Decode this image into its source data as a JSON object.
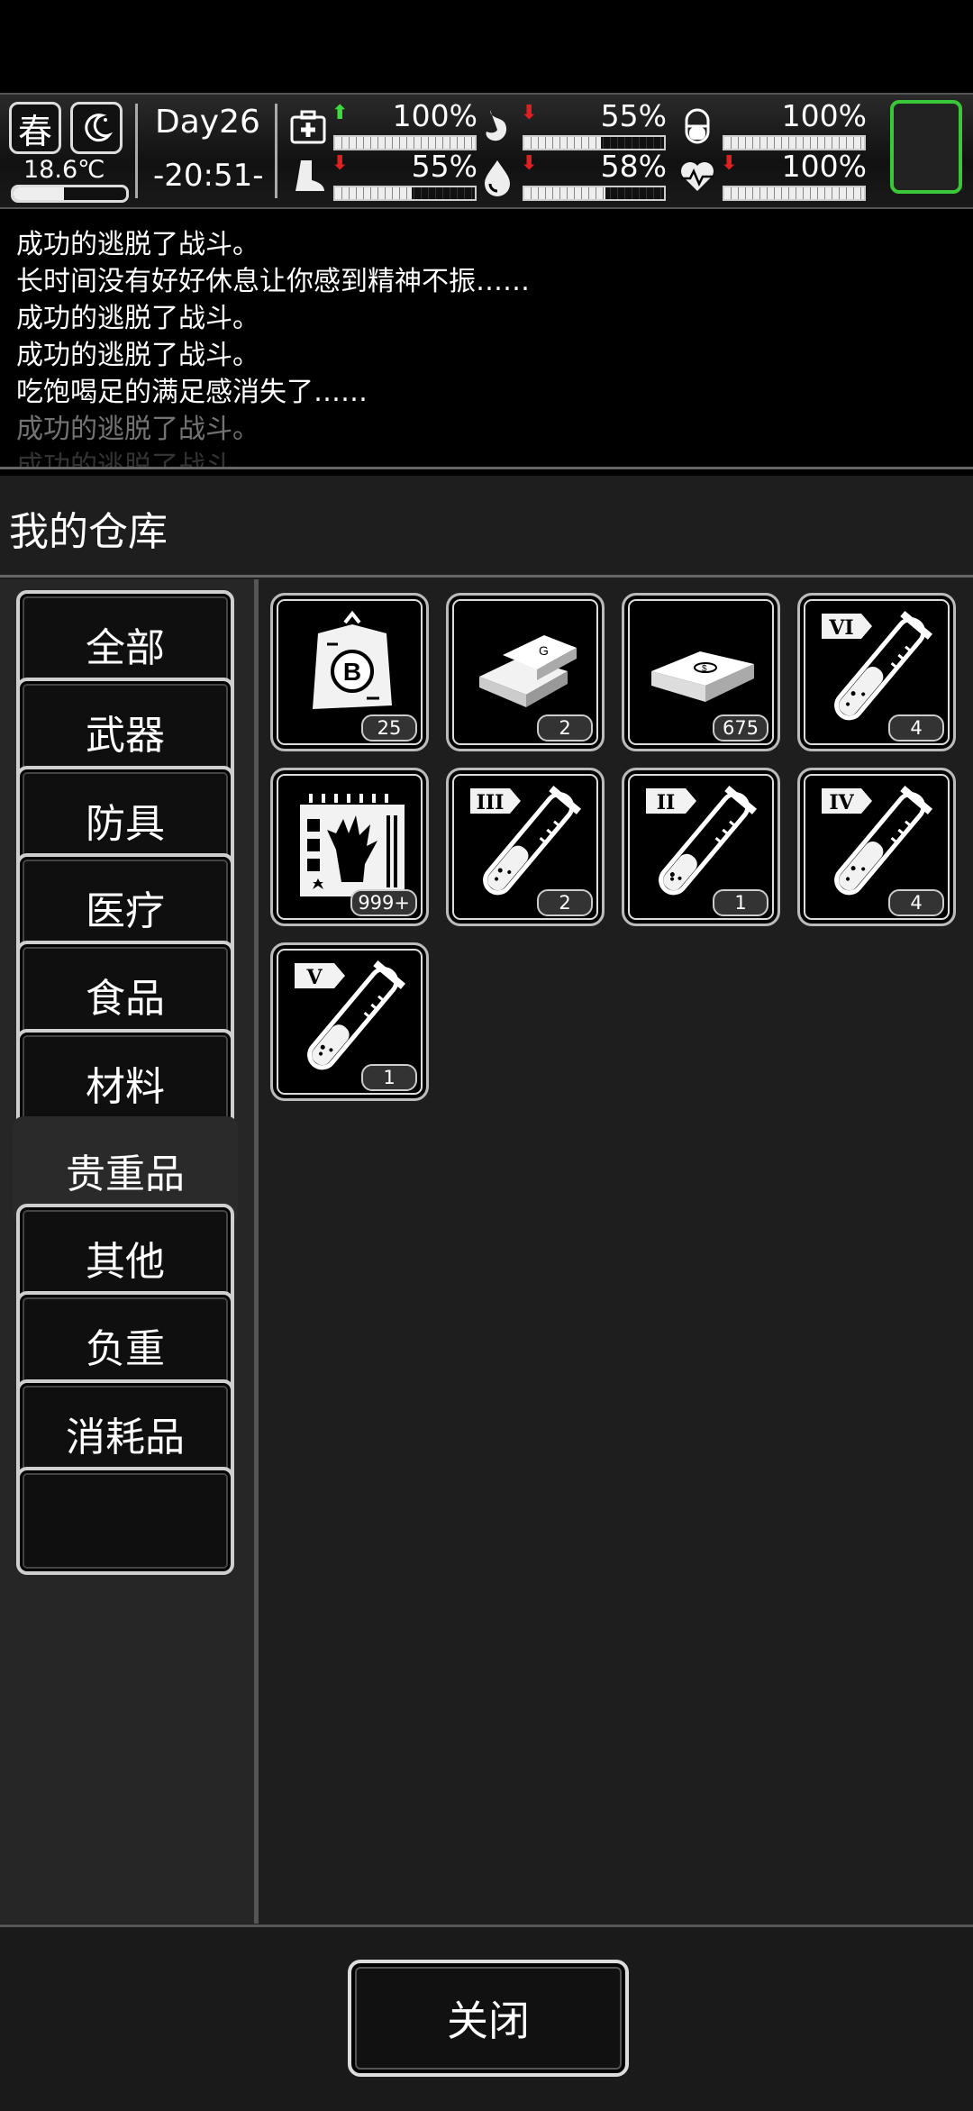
{
  "status": {
    "season": "春",
    "temperature": "18.6℃",
    "temperature_level": 0.45,
    "day": "Day26",
    "time": "-20:51-",
    "stats": [
      {
        "icon": "medkit-icon",
        "value": "100%",
        "level": 1.0,
        "trend": "up"
      },
      {
        "icon": "stomach-icon",
        "value": "55%",
        "level": 0.55,
        "trend": "down"
      },
      {
        "icon": "pill-icon",
        "value": "100%",
        "level": 1.0,
        "trend": "none"
      },
      {
        "icon": "foot-icon",
        "value": "55%",
        "level": 0.55,
        "trend": "down"
      },
      {
        "icon": "water-drop-icon",
        "value": "58%",
        "level": 0.58,
        "trend": "down"
      },
      {
        "icon": "heart-icon",
        "value": "100%",
        "level": 1.0,
        "trend": "down"
      }
    ]
  },
  "log": [
    "成功的逃脱了战斗。",
    "长时间没有好好休息让你感到精神不振……",
    "成功的逃脱了战斗。",
    "成功的逃脱了战斗。",
    "吃饱喝足的满足感消失了……",
    "成功的逃脱了战斗。",
    "成功的逃脱了战斗。"
  ],
  "warehouse": {
    "title": "我的仓库",
    "categories": [
      "全部",
      "武器",
      "防具",
      "医疗",
      "食品",
      "材料",
      "贵重品",
      "其他",
      "负重",
      "消耗品"
    ],
    "selected_category": "贵重品",
    "items": [
      {
        "icon": "bitcoin-map-icon",
        "count": "25"
      },
      {
        "icon": "gold-bar-icon",
        "count": "2"
      },
      {
        "icon": "cash-stack-icon",
        "count": "675"
      },
      {
        "icon": "test-tube-icon",
        "label": "VI",
        "count": "4",
        "fill": 0.55
      },
      {
        "icon": "zombie-hand-card-icon",
        "count": "999+"
      },
      {
        "icon": "test-tube-icon",
        "label": "III",
        "count": "2",
        "fill": 0.5
      },
      {
        "icon": "test-tube-icon",
        "label": "II",
        "count": "1",
        "fill": 0.4
      },
      {
        "icon": "test-tube-icon",
        "label": "IV",
        "count": "4",
        "fill": 0.55
      },
      {
        "icon": "test-tube-icon",
        "label": "V",
        "count": "1",
        "fill": 0.45
      }
    ],
    "close_label": "关闭"
  }
}
